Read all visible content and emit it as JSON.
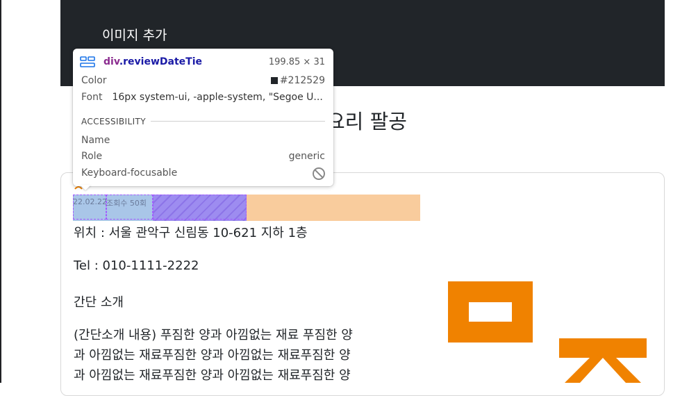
{
  "header": {
    "title": "이미지 추가"
  },
  "page": {
    "heading": "요리 팔공"
  },
  "highlight": {
    "date": "22.02.22",
    "views": "조회수 50회"
  },
  "info": {
    "location": "위치 : 서울 관악구 신림동 10-621 지하 1층",
    "tel": "Tel : 010-1111-2222",
    "intro_label": "간단 소개",
    "intro_lines": [
      "(간단소개 내용) 푸짐한 양과 아낌없는 재료 푸짐한 양",
      "과 아낌없는 재료푸짐한 양과 아낌없는 재료푸짐한 양",
      "과 아낌없는 재료푸짐한 양과 아낌없는 재료푸짐한 양"
    ]
  },
  "tooltip": {
    "tag": "div",
    "class_name": ".reviewDateTie",
    "size": "199.85 × 31",
    "color_label": "Color",
    "color_value": "#212529",
    "font_label": "Font",
    "font_value": "16px system-ui, -apple-system, \"Segoe U...",
    "section": "ACCESSIBILITY",
    "name_label": "Name",
    "role_label": "Role",
    "role_value": "generic",
    "focus_label": "Keyboard-focusable"
  },
  "colors": {
    "accent": "#f08200",
    "header_bg": "#212529"
  }
}
